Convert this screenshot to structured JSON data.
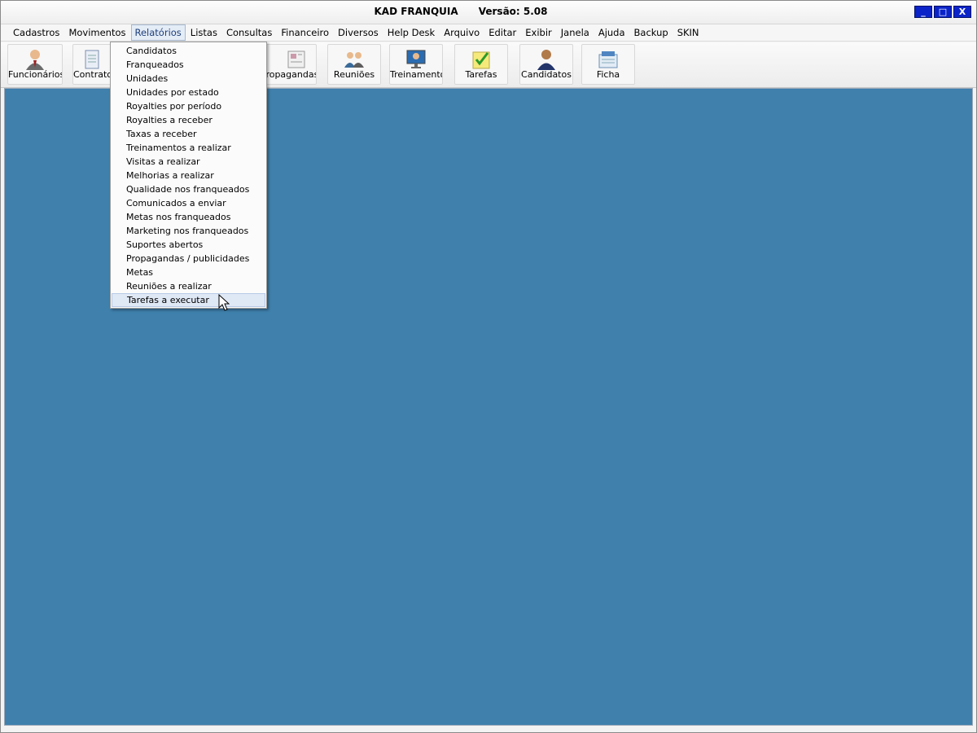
{
  "window": {
    "title": "KAD FRANQUIA      Versão: 5.08",
    "controls": [
      "_",
      "□",
      "X"
    ]
  },
  "menubar": {
    "items": [
      "Cadastros",
      "Movimentos",
      "Relatórios",
      "Listas",
      "Consultas",
      "Financeiro",
      "Diversos",
      "Help Desk",
      "Arquivo",
      "Editar",
      "Exibir",
      "Janela",
      "Ajuda",
      "Backup",
      "SKIN"
    ],
    "open_item": "Relatórios"
  },
  "toolbar": {
    "buttons": [
      {
        "label": "Funcionários",
        "icon": "employee-icon"
      },
      {
        "label": "Contratos",
        "icon": "document-icon"
      },
      {
        "label": "Propagandas",
        "icon": "newspaper-icon"
      },
      {
        "label": "Reuniões",
        "icon": "meeting-icon"
      },
      {
        "label": "Treinamentos",
        "icon": "training-icon"
      },
      {
        "label": "Tarefas",
        "icon": "tasks-icon"
      },
      {
        "label": "Candidatos",
        "icon": "candidate-icon"
      },
      {
        "label": "Ficha",
        "icon": "form-icon"
      }
    ]
  },
  "dropdown": {
    "items": [
      "Candidatos",
      "Franqueados",
      "Unidades",
      "Unidades por estado",
      "Royalties por período",
      "Royalties a receber",
      "Taxas a receber",
      "Treinamentos a realizar",
      "Visitas a realizar",
      "Melhorias a realizar",
      "Qualidade nos franqueados",
      "Comunicados a enviar",
      "Metas nos franqueados",
      "Marketing nos franqueados",
      "Suportes abertos",
      "Propagandas / publicidades",
      "Metas",
      "Reuniões a realizar",
      "Tarefas a executar"
    ],
    "highlighted": "Tarefas a executar"
  },
  "colors": {
    "mdi_background": "#3f80ad",
    "highlight": "#dfe8f5",
    "window_button": "#0b24c9"
  }
}
